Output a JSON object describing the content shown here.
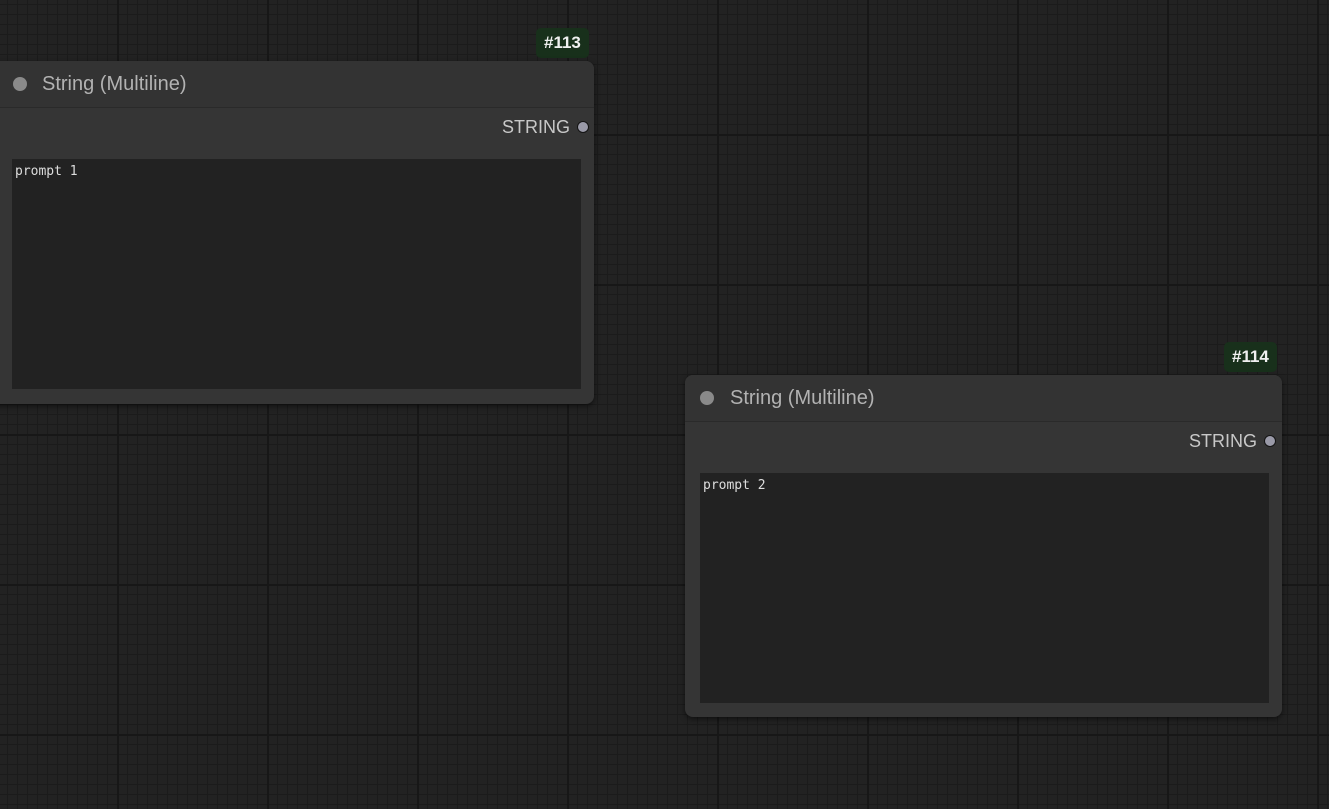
{
  "nodes": [
    {
      "id_badge": "#113",
      "title": "String (Multiline)",
      "output_label": "STRING",
      "text_value": "prompt 1"
    },
    {
      "id_badge": "#114",
      "title": "String (Multiline)",
      "output_label": "STRING",
      "text_value": "prompt 2"
    }
  ],
  "icons": {
    "collapse": "collapse-dot-icon",
    "output_slot": "output-slot-dot-icon"
  },
  "colors": {
    "canvas_background": "#222222",
    "node_body": "#353535",
    "node_header": "#333333",
    "text_widget": "#222222",
    "badge_background": "#18301b"
  }
}
